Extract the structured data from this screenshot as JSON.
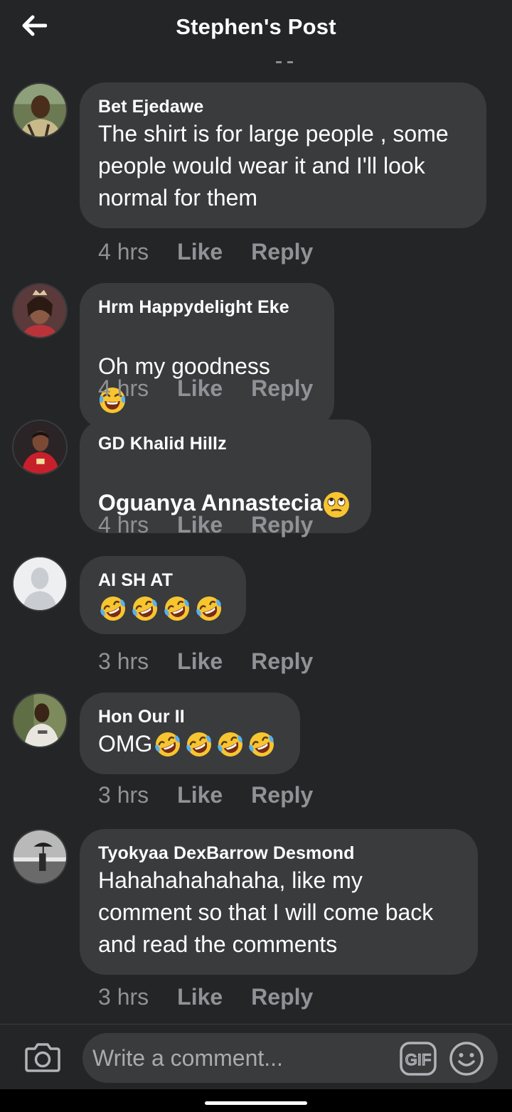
{
  "header": {
    "title": "Stephen's Post",
    "back_icon": "arrow-left-icon"
  },
  "comments": [
    {
      "author": "Bet Ejedawe",
      "text": "The shirt is for large people , some\npeople would wear it and I'll look\nnormal for them",
      "time": "4 hrs",
      "like": "Like",
      "reply": "Reply",
      "avatar": "photo of a man in a patterned shirt",
      "emojis": []
    },
    {
      "author": "Hrm Happydelight Eke",
      "text": "Oh my goodness",
      "time": "4 hrs",
      "like": "Like",
      "reply": "Reply",
      "avatar": "photo of a woman with a crown",
      "emojis": [
        "tears-of-joy"
      ]
    },
    {
      "author": "GD Khalid Hillz",
      "text": "Oguanya Annastecia",
      "time": "4 hrs",
      "like": "Like",
      "reply": "Reply",
      "avatar": "photo of a footballer in a red jersey",
      "emojis": [
        "rolling-eyes"
      ]
    },
    {
      "author": "AI SH AT",
      "text": "",
      "time": "3 hrs",
      "like": "Like",
      "reply": "Reply",
      "avatar": "default profile silhouette",
      "emojis": [
        "rolling-laughing",
        "rolling-laughing",
        "rolling-laughing",
        "rolling-laughing"
      ]
    },
    {
      "author": "Hon Our II",
      "text": "OMG",
      "time": "3 hrs",
      "like": "Like",
      "reply": "Reply",
      "avatar": "photo of a man in a white t-shirt",
      "emojis": [
        "rolling-laughing",
        "rolling-laughing",
        "rolling-laughing",
        "rolling-laughing"
      ]
    },
    {
      "author": "Tyokyaa DexBarrow Desmond",
      "text": "Hahahahahahaha, like my\ncomment so that I will come back\nand read the comments",
      "time": "3 hrs",
      "like": "Like",
      "reply": "Reply",
      "avatar": "grayscale photo of a person with umbrella",
      "emojis": []
    }
  ],
  "composer": {
    "placeholder": "Write a comment...",
    "camera_icon": "camera-icon",
    "gif_label": "GIF",
    "emoji_icon": "smiley-icon"
  },
  "colors": {
    "background": "#242526",
    "bubble": "#3a3b3c",
    "secondary_text": "#8f9296",
    "primary_text": "#ffffff"
  }
}
